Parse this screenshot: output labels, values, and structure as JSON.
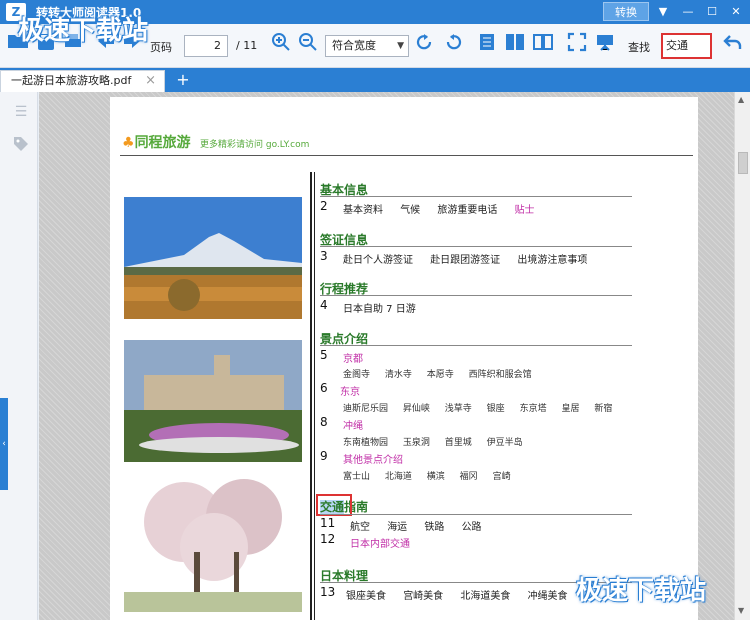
{
  "app": {
    "title": "转转大师阅读器1.0",
    "logo_text": "Z",
    "convert_label": "转换"
  },
  "window_controls": {
    "menu": "▼",
    "minimize": "—",
    "maximize": "☐",
    "close": "✕"
  },
  "toolbar": {
    "page_label": "页码",
    "page_value": "2",
    "page_total": "/ 11",
    "fit_value": "符合宽度",
    "search_label": "查找",
    "search_value": "交通"
  },
  "tabs": [
    {
      "label": "一起游日本旅游攻略.pdf",
      "close": "×"
    }
  ],
  "add_tab": "+",
  "watermark": {
    "top": "极速下载站",
    "bottom": "极速下载站"
  },
  "document": {
    "brand": "同程旅游",
    "brand_sub": "更多精彩请访问 go.LY.com",
    "sections": [
      {
        "title": "基本信息",
        "num": "2",
        "items": [
          "基本资料",
          "气候",
          "旅游重要电话",
          "贴士"
        ]
      },
      {
        "title": "签证信息",
        "num": "3",
        "items": [
          "赴日个人游签证",
          "赴日跟团游签证",
          "出境游注意事项"
        ]
      },
      {
        "title": "行程推荐",
        "num": "4",
        "items": [
          "日本自助 7 日游"
        ]
      },
      {
        "title": "景点介绍",
        "groups": [
          {
            "num": "5",
            "name": "京都",
            "subs": [
              "金阁寺",
              "清水寺",
              "本愿寺",
              "西阵织和服会馆"
            ]
          },
          {
            "num": "6",
            "name": "东京",
            "subs": [
              "迪斯尼乐园",
              "昇仙峡",
              "浅草寺",
              "银座",
              "东京塔",
              "皇居",
              "新宿"
            ]
          },
          {
            "num": "8",
            "name": "冲绳",
            "subs": [
              "东南植物园",
              "玉泉洞",
              "首里城",
              "伊豆半岛"
            ]
          },
          {
            "num": "9",
            "name": "其他景点介绍",
            "subs": [
              "富士山",
              "北海道",
              "横滨",
              "福冈",
              "宫崎"
            ]
          }
        ]
      },
      {
        "title_hl": "交通",
        "title_rest": "指南",
        "rows": [
          {
            "num": "11",
            "items": [
              "航空",
              "海运",
              "铁路",
              "公路"
            ]
          },
          {
            "num": "12",
            "items": [
              "日本内部交通"
            ]
          }
        ]
      },
      {
        "title": "日本料理",
        "num": "13",
        "items": [
          "银座美食",
          "宫崎美食",
          "北海道美食",
          "冲绳美食"
        ]
      }
    ]
  },
  "colors": {
    "accent": "#2b7fd3",
    "section_green": "#2a7a2a",
    "link_pink": "#c12fa7",
    "highlight_red": "#dd3333"
  }
}
